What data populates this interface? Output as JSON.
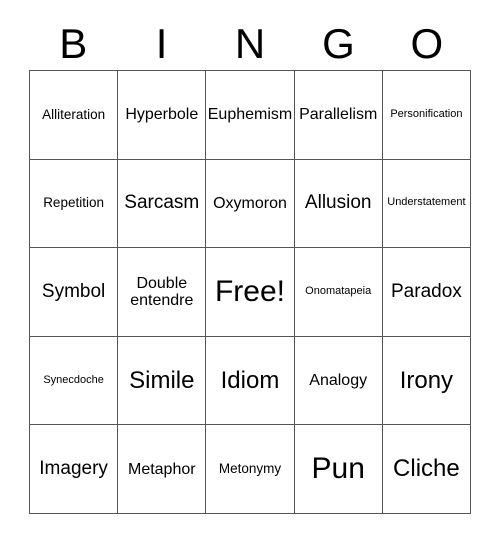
{
  "card": {
    "title_letters": [
      "B",
      "I",
      "N",
      "G",
      "O"
    ],
    "columns": 5,
    "rows": 5,
    "free_space_label": "Free!",
    "free_space_position": {
      "row": 3,
      "column": 3
    },
    "grid_line_color": "#555555",
    "text_color": "#000000",
    "background_color": "#ffffff",
    "cells": [
      [
        {
          "label": "Alliteration",
          "size": "sm"
        },
        {
          "label": "Hyperbole",
          "size": "md"
        },
        {
          "label": "Euphemism",
          "size": "md"
        },
        {
          "label": "Parallelism",
          "size": "md"
        },
        {
          "label": "Personification",
          "size": "xs"
        }
      ],
      [
        {
          "label": "Repetition",
          "size": "sm"
        },
        {
          "label": "Sarcasm",
          "size": "lg"
        },
        {
          "label": "Oxymoron",
          "size": "md"
        },
        {
          "label": "Allusion",
          "size": "lg"
        },
        {
          "label": "Understatement",
          "size": "xs"
        }
      ],
      [
        {
          "label": "Symbol",
          "size": "lg"
        },
        {
          "label": "Double entendre",
          "size": "md"
        },
        {
          "label": "Free!",
          "size": "xxl"
        },
        {
          "label": "Onomatapeia",
          "size": "xs"
        },
        {
          "label": "Paradox",
          "size": "lg"
        }
      ],
      [
        {
          "label": "Synecdoche",
          "size": "xs"
        },
        {
          "label": "Simile",
          "size": "xl"
        },
        {
          "label": "Idiom",
          "size": "xl"
        },
        {
          "label": "Analogy",
          "size": "md"
        },
        {
          "label": "Irony",
          "size": "xl"
        }
      ],
      [
        {
          "label": "Imagery",
          "size": "lg"
        },
        {
          "label": "Metaphor",
          "size": "md"
        },
        {
          "label": "Metonymy",
          "size": "sm"
        },
        {
          "label": "Pun",
          "size": "xxl"
        },
        {
          "label": "Cliche",
          "size": "xl"
        }
      ]
    ]
  }
}
